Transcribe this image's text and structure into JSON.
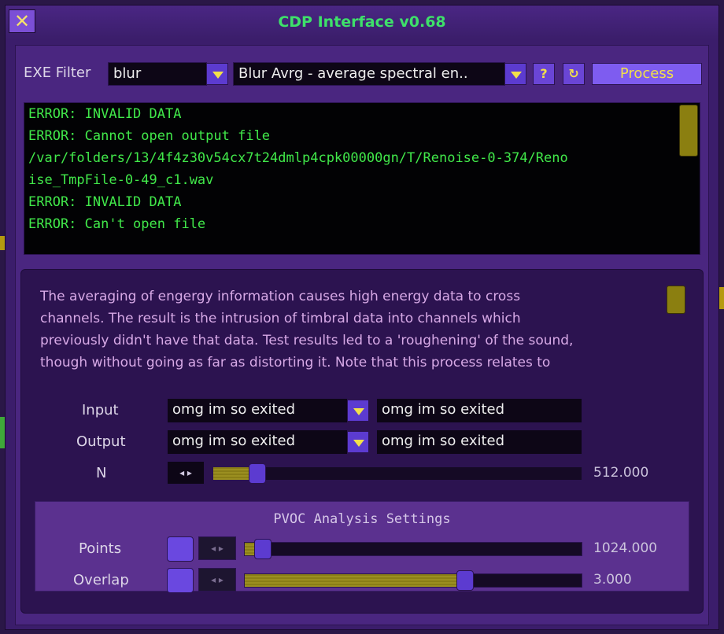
{
  "window": {
    "title": "CDP Interface v0.68",
    "close_glyph": "✕"
  },
  "filter": {
    "label": "EXE Filter",
    "exe_value": "blur",
    "process_value": "Blur Avrg - average spectral en..",
    "help_label": "?",
    "refresh_glyph": "↻",
    "process_label": "Process"
  },
  "log": {
    "lines": [
      "ERROR: INVALID DATA",
      "ERROR: Cannot open output file",
      "/var/folders/13/4f4z30v54cx7t24dmlp4cpk00000gn/T/Renoise-0-374/Reno",
      "ise_TmpFile-0-49_c1.wav",
      "ERROR: INVALID DATA",
      "ERROR: Can't open file"
    ]
  },
  "description": {
    "lines": [
      "The averaging of engergy information causes high energy data to cross",
      "channels. The result is the intrusion of timbral data into channels which",
      "previously didn't have that data. Test results led to a 'roughening' of the sound,",
      "though without going as far as distorting it. Note that this process relates to"
    ]
  },
  "params": {
    "input_label": "Input",
    "input_select": "omg im so exited",
    "input_name": "omg im so exited",
    "output_label": "Output",
    "output_select": "omg im so exited",
    "output_name": "omg im so exited",
    "n_label": "N",
    "n_value_text": "512.000",
    "n_fraction": 0.1,
    "nudge_glyph": "◂ ▸"
  },
  "pvoc": {
    "title": "PVOC Analysis Settings",
    "points_label": "Points",
    "points_value_text": "1024.000",
    "points_fraction": 0.03,
    "overlap_label": "Overlap",
    "overlap_value_text": "3.000",
    "overlap_fraction": 0.66
  },
  "colors": {
    "title_green": "#3ee06a",
    "log_green": "#41e84a",
    "accent_yellow": "#f2e04a",
    "panel_purple": "#4a2680"
  },
  "icons": [
    "close-icon",
    "dropdown-arrow-icon",
    "help-icon",
    "refresh-icon",
    "nudge-arrows-icon"
  ]
}
